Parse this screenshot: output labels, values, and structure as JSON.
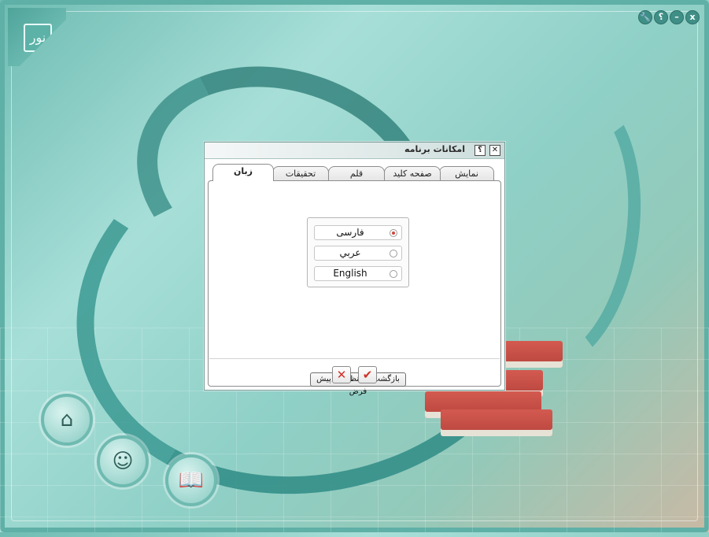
{
  "window_controls": {
    "close_glyph": "x",
    "minimize_glyph": "–",
    "help_glyph": "؟",
    "settings_glyph": "🔧"
  },
  "corner_logo_text": "نور",
  "dialog": {
    "title": "امکانات برنامه",
    "help_glyph": "؟",
    "close_glyph": "✕",
    "tabs": [
      {
        "label": "نمایش"
      },
      {
        "label": "صفحه کلید"
      },
      {
        "label": "قلم"
      },
      {
        "label": "تحقیقات"
      },
      {
        "label": "زبان"
      }
    ],
    "active_tab": "زبان",
    "languages": [
      {
        "label": "فارسی",
        "selected": true
      },
      {
        "label": "عربي",
        "selected": false
      },
      {
        "label": "English",
        "selected": false
      }
    ],
    "reset_button_label": "بازگشت به تنظیمات پیش فرض",
    "cancel_glyph": "✕",
    "ok_glyph": "✔"
  },
  "colors": {
    "accent": "#5fb0a6",
    "radio_selected": "#d2473c",
    "action_red": "#d0302a"
  }
}
